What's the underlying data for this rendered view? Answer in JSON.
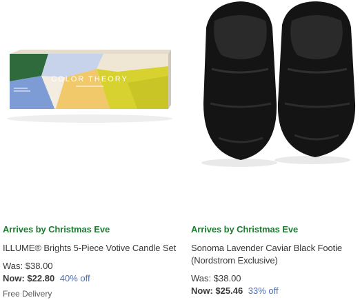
{
  "products": [
    {
      "image_label": "COLOR THEORY",
      "arrives": "Arrives by Christmas Eve",
      "title": "ILLUME® Brights 5-Piece Votive Candle Set",
      "was_label": "Was:",
      "was_price": "$38.00",
      "now_label": "Now:",
      "now_price": "$22.80",
      "discount": "40% off",
      "delivery": "Free Delivery"
    },
    {
      "arrives": "Arrives by Christmas Eve",
      "title": "Sonoma Lavender Caviar Black Footie (Nordstrom Exclusive)",
      "was_label": "Was:",
      "was_price": "$38.00",
      "now_label": "Now:",
      "now_price": "$25.46",
      "discount": "33% off"
    }
  ],
  "colors": {
    "arrives_green": "#1e7d32",
    "discount_blue": "#4a6fbf",
    "text": "#393939"
  }
}
